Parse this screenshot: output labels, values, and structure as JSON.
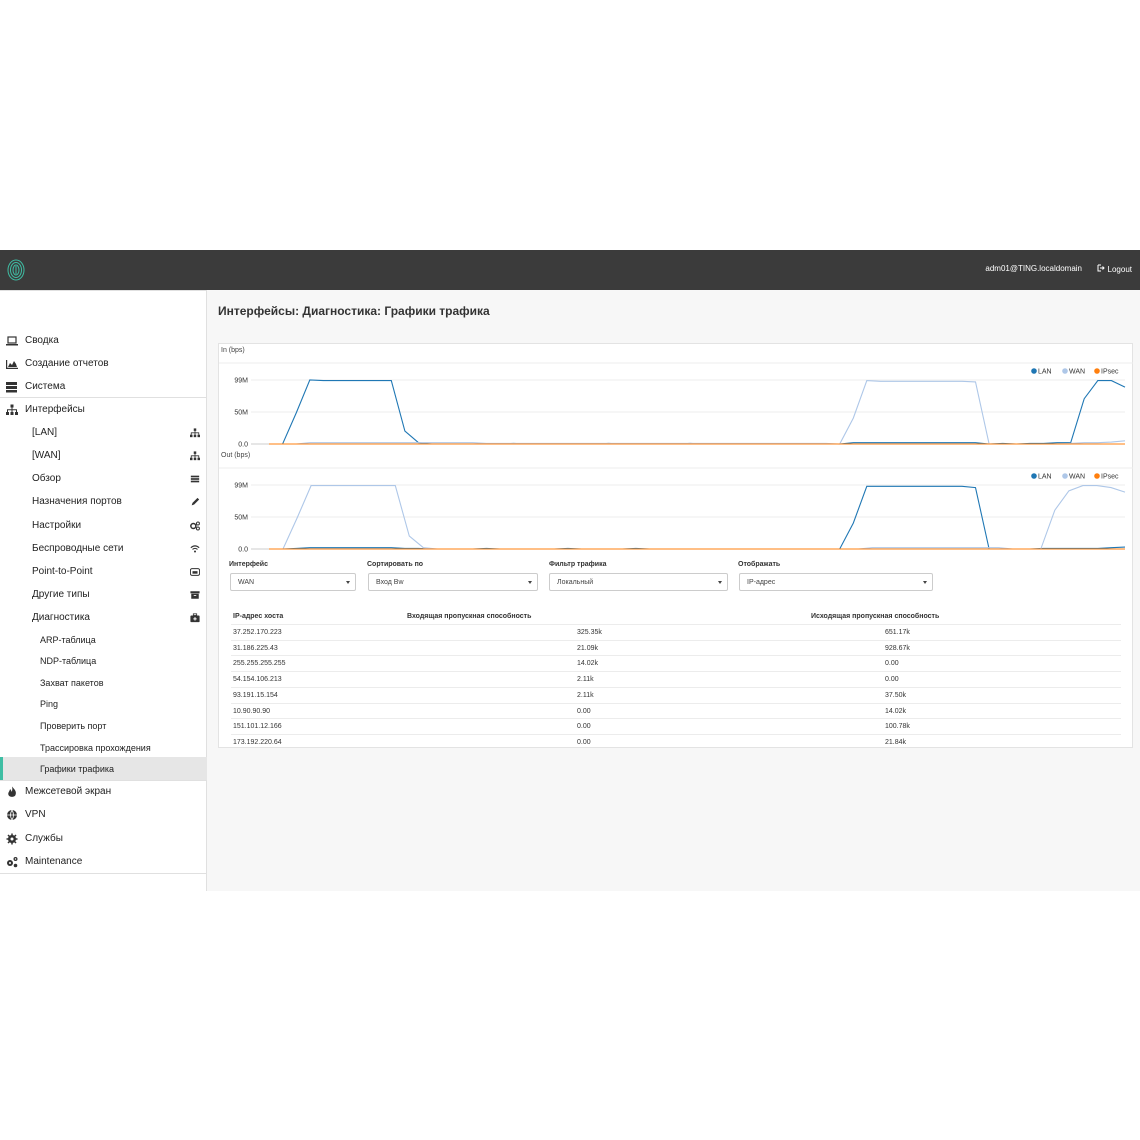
{
  "header": {
    "user": "adm01@TING.localdomain",
    "logout_label": "Logout"
  },
  "page": {
    "title": "Интерфейсы: Диагностика: Графики трафика"
  },
  "sidebar": {
    "items": [
      {
        "label": "Сводка",
        "icon": "laptop-icon"
      },
      {
        "label": "Создание отчетов",
        "icon": "area-chart-icon"
      },
      {
        "label": "Система",
        "icon": "server-icon"
      },
      {
        "label": "Интерфейсы",
        "icon": "sitemap-icon"
      },
      {
        "label": "[LAN]",
        "icon": "sitemap-icon"
      },
      {
        "label": "[WAN]",
        "icon": "sitemap-icon"
      },
      {
        "label": "Обзор",
        "icon": "list-icon"
      },
      {
        "label": "Назначения портов",
        "icon": "pencil-icon"
      },
      {
        "label": "Настройки",
        "icon": "gears-icon"
      },
      {
        "label": "Беспроводные сети",
        "icon": "wifi-icon"
      },
      {
        "label": "Point-to-Point",
        "icon": "phone-icon"
      },
      {
        "label": "Другие типы",
        "icon": "archive-icon"
      },
      {
        "label": "Диагностика",
        "icon": "medkit-icon"
      },
      {
        "label": "ARP-таблица"
      },
      {
        "label": "NDP-таблица"
      },
      {
        "label": "Захват пакетов"
      },
      {
        "label": "Ping"
      },
      {
        "label": "Проверить порт"
      },
      {
        "label": "Трассировка прохождения"
      },
      {
        "label": "Графики трафика"
      },
      {
        "label": "Межсетевой экран",
        "icon": "fire-icon"
      },
      {
        "label": "VPN",
        "icon": "globe-icon"
      },
      {
        "label": "Службы",
        "icon": "cog-icon"
      },
      {
        "label": "Maintenance",
        "icon": "cogs-icon"
      }
    ]
  },
  "chart_data": [
    {
      "type": "line",
      "title": "In (bps)",
      "y_ticks": [
        "99M",
        "50M",
        "0.0"
      ],
      "ylim": [
        0,
        99
      ],
      "series": [
        {
          "name": "LAN",
          "color": "#1f77b4",
          "values": [
            0,
            0,
            48,
            99,
            98,
            98,
            98,
            98,
            98,
            98,
            20,
            2,
            0,
            0,
            0,
            0,
            0,
            0,
            1,
            0,
            0,
            0,
            0,
            0,
            0,
            1,
            0,
            0,
            0,
            0,
            0,
            1,
            0,
            0,
            0,
            0,
            0,
            0,
            0,
            0,
            0,
            0,
            0,
            2,
            2,
            2,
            2,
            2,
            2,
            2,
            2,
            2,
            2,
            0,
            1,
            0,
            1,
            1,
            2,
            2,
            70,
            98,
            98,
            88
          ]
        },
        {
          "name": "WAN",
          "color": "#aec7e8",
          "values": [
            0,
            0,
            0,
            2,
            2,
            2,
            2,
            2,
            2,
            2,
            2,
            2,
            2,
            2,
            2,
            2,
            1,
            1,
            1,
            1,
            1,
            1,
            1,
            1,
            1,
            1,
            1,
            1,
            1,
            1,
            1,
            1,
            1,
            1,
            1,
            1,
            1,
            1,
            1,
            1,
            1,
            1,
            0,
            40,
            98,
            97,
            97,
            97,
            97,
            97,
            97,
            97,
            96,
            0,
            0,
            0,
            0,
            0,
            0,
            1,
            2,
            2,
            3,
            5
          ]
        },
        {
          "name": "IPsec",
          "color": "#ff7f0e",
          "values": [
            0,
            0,
            0,
            0,
            0,
            0,
            0,
            0,
            0,
            0,
            0,
            0,
            0,
            0,
            0,
            0,
            0,
            0,
            0,
            0,
            0,
            0,
            0,
            0,
            0,
            0,
            0,
            0,
            0,
            0,
            0,
            0,
            0,
            0,
            0,
            0,
            0,
            0,
            0,
            0,
            0,
            0,
            0,
            0,
            0,
            0,
            0,
            0,
            0,
            0,
            0,
            0,
            0,
            0,
            0,
            0,
            0,
            0,
            0,
            0,
            0,
            0,
            0,
            0
          ]
        }
      ]
    },
    {
      "type": "line",
      "title": "Out (bps)",
      "y_ticks": [
        "99M",
        "50M",
        "0.0"
      ],
      "ylim": [
        0,
        99
      ],
      "series": [
        {
          "name": "LAN",
          "color": "#1f77b4",
          "values": [
            0,
            0,
            1,
            2,
            2,
            2,
            2,
            2,
            2,
            2,
            1,
            1,
            0,
            0,
            0,
            0,
            1,
            0,
            0,
            0,
            0,
            0,
            1,
            0,
            0,
            0,
            0,
            1,
            0,
            0,
            0,
            0,
            0,
            0,
            0,
            0,
            0,
            0,
            0,
            0,
            0,
            0,
            0,
            40,
            97,
            97,
            97,
            97,
            97,
            97,
            97,
            97,
            95,
            0,
            0,
            0,
            0,
            1,
            1,
            1,
            1,
            1,
            2,
            3
          ]
        },
        {
          "name": "WAN",
          "color": "#aec7e8",
          "values": [
            0,
            0,
            48,
            98,
            98,
            98,
            98,
            98,
            98,
            98,
            20,
            2,
            0,
            0,
            0,
            0,
            0,
            0,
            0,
            0,
            0,
            0,
            0,
            0,
            0,
            0,
            0,
            0,
            0,
            0,
            0,
            0,
            0,
            0,
            0,
            0,
            0,
            0,
            0,
            0,
            0,
            0,
            0,
            2,
            2,
            2,
            2,
            2,
            2,
            2,
            2,
            2,
            2,
            0,
            0,
            0,
            60,
            90,
            98,
            98,
            95,
            88
          ]
        },
        {
          "name": "IPsec",
          "color": "#ff7f0e",
          "values": [
            0,
            0,
            0,
            0,
            0,
            0,
            0,
            0,
            0,
            0,
            0,
            0,
            0,
            0,
            0,
            0,
            0,
            0,
            0,
            0,
            0,
            0,
            0,
            0,
            0,
            0,
            0,
            0,
            0,
            0,
            0,
            0,
            0,
            0,
            0,
            0,
            0,
            0,
            0,
            0,
            0,
            0,
            0,
            0,
            0,
            0,
            0,
            0,
            0,
            0,
            0,
            0,
            0,
            0,
            0,
            0,
            0,
            0,
            0,
            0,
            0,
            0
          ]
        }
      ]
    }
  ],
  "filters": [
    {
      "label": "Интерфейс",
      "value": "WAN"
    },
    {
      "label": "Сортировать по",
      "value": "Вход Bw"
    },
    {
      "label": "Фильтр трафика",
      "value": "Локальный"
    },
    {
      "label": "Отображать",
      "value": "IP-адрес"
    }
  ],
  "table": {
    "headers": [
      "IP-адрес хоста",
      "Входящая пропускная способность",
      "Исходящая пропускная способность"
    ],
    "rows": [
      [
        "37.252.170.223",
        "325.35k",
        "651.17k"
      ],
      [
        "31.186.225.43",
        "21.09k",
        "928.67k"
      ],
      [
        "255.255.255.255",
        "14.02k",
        "0.00"
      ],
      [
        "54.154.106.213",
        "2.11k",
        "0.00"
      ],
      [
        "93.191.15.154",
        "2.11k",
        "37.50k"
      ],
      [
        "10.90.90.90",
        "0.00",
        "14.02k"
      ],
      [
        "151.101.12.166",
        "0.00",
        "100.78k"
      ],
      [
        "173.192.220.64",
        "0.00",
        "21.84k"
      ]
    ]
  },
  "colors": {
    "accent": "#3fbea4",
    "topbar": "#3b3b3b"
  }
}
